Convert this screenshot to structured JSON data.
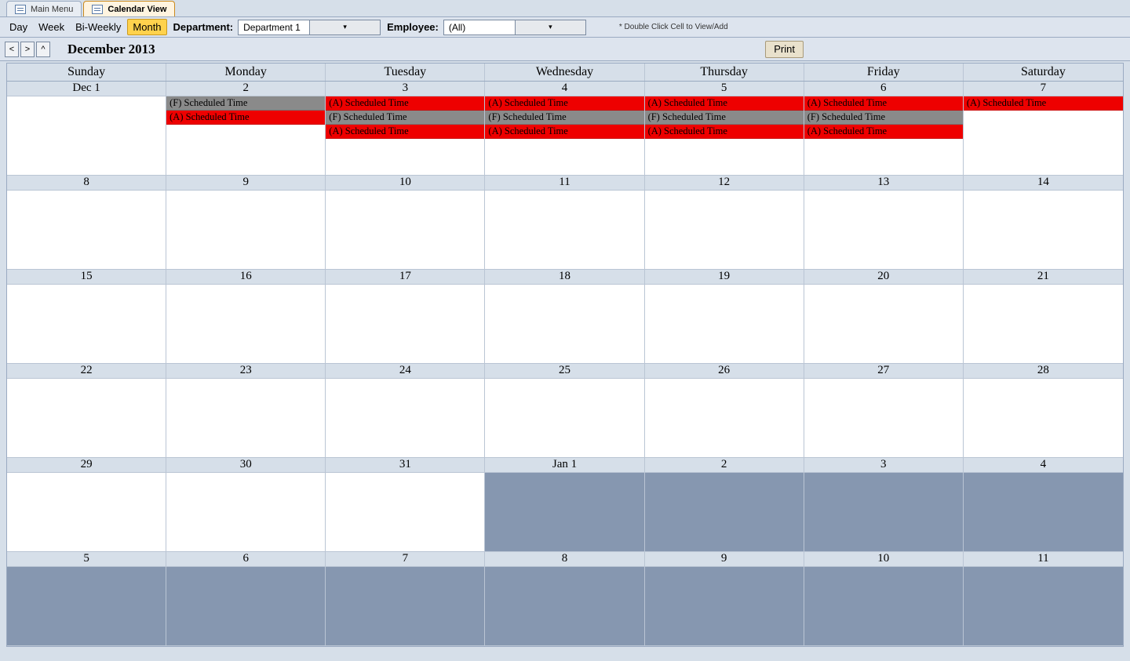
{
  "tabs": {
    "main_menu": "Main Menu",
    "calendar_view": "Calendar View"
  },
  "toolbar": {
    "views": {
      "day": "Day",
      "week": "Week",
      "biweekly": "Bi-Weekly",
      "month": "Month"
    },
    "department_label": "Department:",
    "department_value": "Department 1",
    "employee_label": "Employee:",
    "employee_value": "(All)",
    "hint": "* Double Click Cell to View/Add"
  },
  "nav": {
    "prev": "<",
    "next": ">",
    "today": "^",
    "title": "December 2013",
    "print": "Print"
  },
  "dow": [
    "Sunday",
    "Monday",
    "Tuesday",
    "Wednesday",
    "Thursday",
    "Friday",
    "Saturday"
  ],
  "cells": [
    {
      "label": "Dec 1",
      "other": false,
      "events": []
    },
    {
      "label": "2",
      "other": false,
      "events": [
        {
          "c": "gray",
          "t": "(F) Scheduled Time"
        },
        {
          "c": "red",
          "t": "(A) Scheduled Time"
        }
      ]
    },
    {
      "label": "3",
      "other": false,
      "events": [
        {
          "c": "red",
          "t": "(A) Scheduled Time"
        },
        {
          "c": "gray",
          "t": "(F) Scheduled Time"
        },
        {
          "c": "red",
          "t": "(A) Scheduled Time"
        }
      ]
    },
    {
      "label": "4",
      "other": false,
      "events": [
        {
          "c": "red",
          "t": "(A) Scheduled Time"
        },
        {
          "c": "gray",
          "t": "(F) Scheduled Time"
        },
        {
          "c": "red",
          "t": "(A) Scheduled Time"
        }
      ]
    },
    {
      "label": "5",
      "other": false,
      "events": [
        {
          "c": "red",
          "t": "(A) Scheduled Time"
        },
        {
          "c": "gray",
          "t": "(F) Scheduled Time"
        },
        {
          "c": "red",
          "t": "(A) Scheduled Time"
        }
      ]
    },
    {
      "label": "6",
      "other": false,
      "events": [
        {
          "c": "red",
          "t": "(A) Scheduled Time"
        },
        {
          "c": "gray",
          "t": "(F) Scheduled Time"
        },
        {
          "c": "red",
          "t": "(A) Scheduled Time"
        }
      ]
    },
    {
      "label": "7",
      "other": false,
      "events": [
        {
          "c": "red",
          "t": "(A) Scheduled Time"
        }
      ]
    },
    {
      "label": "8",
      "other": false,
      "events": []
    },
    {
      "label": "9",
      "other": false,
      "events": []
    },
    {
      "label": "10",
      "other": false,
      "events": []
    },
    {
      "label": "11",
      "other": false,
      "events": []
    },
    {
      "label": "12",
      "other": false,
      "events": []
    },
    {
      "label": "13",
      "other": false,
      "events": []
    },
    {
      "label": "14",
      "other": false,
      "events": []
    },
    {
      "label": "15",
      "other": false,
      "events": []
    },
    {
      "label": "16",
      "other": false,
      "events": []
    },
    {
      "label": "17",
      "other": false,
      "events": []
    },
    {
      "label": "18",
      "other": false,
      "events": []
    },
    {
      "label": "19",
      "other": false,
      "events": []
    },
    {
      "label": "20",
      "other": false,
      "events": []
    },
    {
      "label": "21",
      "other": false,
      "events": []
    },
    {
      "label": "22",
      "other": false,
      "events": []
    },
    {
      "label": "23",
      "other": false,
      "events": []
    },
    {
      "label": "24",
      "other": false,
      "events": []
    },
    {
      "label": "25",
      "other": false,
      "events": []
    },
    {
      "label": "26",
      "other": false,
      "events": []
    },
    {
      "label": "27",
      "other": false,
      "events": []
    },
    {
      "label": "28",
      "other": false,
      "events": []
    },
    {
      "label": "29",
      "other": false,
      "events": []
    },
    {
      "label": "30",
      "other": false,
      "events": []
    },
    {
      "label": "31",
      "other": false,
      "events": []
    },
    {
      "label": "Jan 1",
      "other": true,
      "events": []
    },
    {
      "label": "2",
      "other": true,
      "events": []
    },
    {
      "label": "3",
      "other": true,
      "events": []
    },
    {
      "label": "4",
      "other": true,
      "events": []
    },
    {
      "label": "5",
      "other": true,
      "events": []
    },
    {
      "label": "6",
      "other": true,
      "events": []
    },
    {
      "label": "7",
      "other": true,
      "events": []
    },
    {
      "label": "8",
      "other": true,
      "events": []
    },
    {
      "label": "9",
      "other": true,
      "events": []
    },
    {
      "label": "10",
      "other": true,
      "events": []
    },
    {
      "label": "11",
      "other": true,
      "events": []
    }
  ]
}
